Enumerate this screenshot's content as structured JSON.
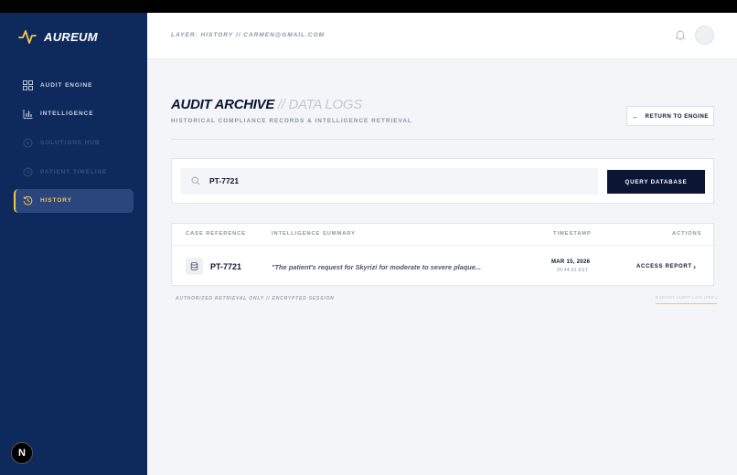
{
  "brand": {
    "name": "AUREUM"
  },
  "sidebar": {
    "items": [
      {
        "label": "AUDIT ENGINE",
        "icon": "grid-icon"
      },
      {
        "label": "INTELLIGENCE",
        "icon": "bar-chart-icon"
      },
      {
        "label": "SOLUTIONS HUB",
        "icon": "circle-icon"
      },
      {
        "label": "PATIENT TIMELINE",
        "icon": "clock-icon"
      },
      {
        "label": "HISTORY",
        "icon": "history-icon",
        "active": true
      }
    ],
    "badge": "N"
  },
  "header": {
    "breadcrumb": "LAYER: HISTORY // CARMEN@GMAIL.COM"
  },
  "page": {
    "title": "AUDIT ARCHIVE",
    "title_suffix": " // DATA LOGS",
    "subtitle": "HISTORICAL COMPLIANCE RECORDS & INTELLIGENCE RETRIEVAL",
    "return_label": "RETURN TO ENGINE"
  },
  "search": {
    "value": "PT-7721",
    "button": "QUERY DATABASE"
  },
  "table": {
    "columns": [
      "CASE REFERENCE",
      "INTELLIGENCE SUMMARY",
      "TIMESTAMP",
      "ACTIONS"
    ],
    "rows": [
      {
        "case_ref": "PT-7721",
        "summary": "\"The patient's request for Skyrizi for moderate to severe plaque...",
        "date": "MAR 15, 2026",
        "time": "05:44:01 EST",
        "action": "ACCESS REPORT"
      }
    ]
  },
  "footer": {
    "note": "AUTHORIZED RETRIEVAL ONLY // ENCRYPTED SESSION",
    "export": "EXPORT AUDIT LOG (PDF)"
  },
  "colors": {
    "sidebar": "#0e2a5c",
    "accent": "#f3c84b",
    "primary": "#0b1634"
  }
}
